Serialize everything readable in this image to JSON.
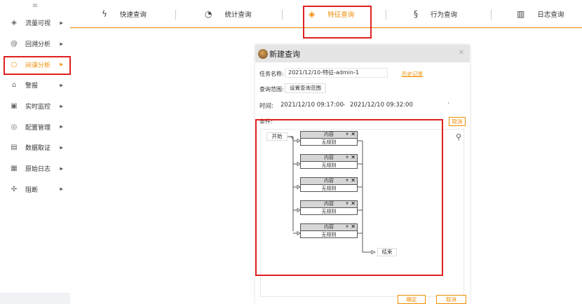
{
  "sidebar": {
    "items": [
      {
        "label": "流量可视",
        "icon": "layers-icon"
      },
      {
        "label": "回溯分析",
        "icon": "at-icon"
      },
      {
        "label": "间谍分析",
        "icon": "search-icon"
      },
      {
        "label": "警报",
        "icon": "alarm-icon"
      },
      {
        "label": "实时监控",
        "icon": "monitor-icon"
      },
      {
        "label": "配置管理",
        "icon": "settings-icon"
      },
      {
        "label": "数据取证",
        "icon": "document-icon"
      },
      {
        "label": "原始日志",
        "icon": "log-icon"
      },
      {
        "label": "阻断",
        "icon": "puzzle-icon"
      }
    ]
  },
  "tabs": [
    {
      "label": "快速查询",
      "icon": "lightning-icon"
    },
    {
      "label": "统计查询",
      "icon": "pie-icon"
    },
    {
      "label": "特征查询",
      "icon": "diamond-icon"
    },
    {
      "label": "行为查询",
      "icon": "behavior-icon"
    },
    {
      "label": "日志查询",
      "icon": "clipboard-icon"
    }
  ],
  "modal": {
    "title": "新建查询",
    "task_label": "任务名称:",
    "task_value": "2021/12/10-特征-admin-1",
    "history_link": "历史记录",
    "range_label": "查询范围:",
    "range_button": "设置查询范围",
    "time_label": "时间:",
    "time_start": "2021/12/10 09:17:00",
    "time_sep": "-",
    "time_end": "2021/12/10 09:32:00",
    "time_dot": "·",
    "condition_label": "条件:",
    "cancel_small": "取消",
    "ok": "确定",
    "cancel": "取消",
    "flow": {
      "start": "开始",
      "end": "结束",
      "nodes": [
        {
          "header": "内容",
          "body": "无规则"
        },
        {
          "header": "内容",
          "body": "无规则"
        },
        {
          "header": "内容",
          "body": "无规则"
        },
        {
          "header": "内容",
          "body": "无规则"
        },
        {
          "header": "内容",
          "body": "无规则"
        }
      ]
    }
  },
  "colors": {
    "accent": "#f08c00",
    "highlight": "#e02020"
  }
}
